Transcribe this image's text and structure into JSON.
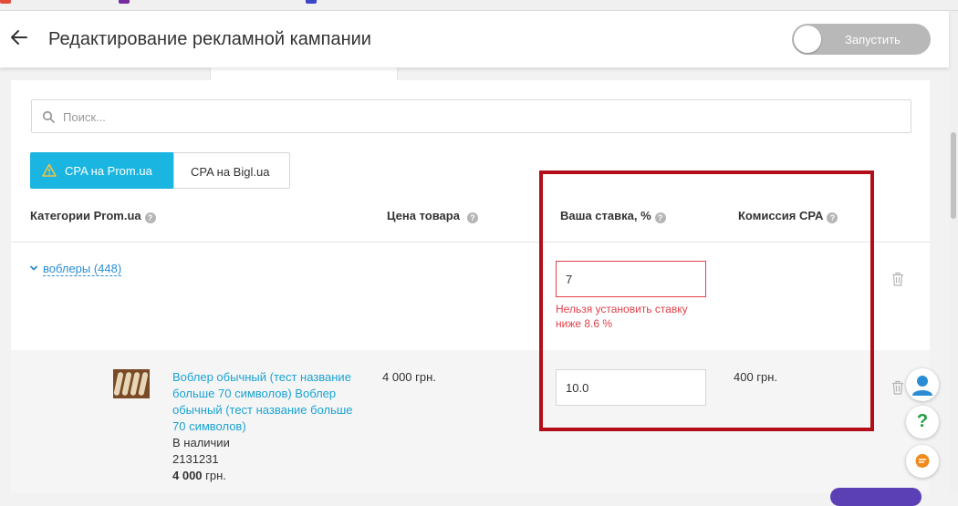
{
  "header": {
    "title": "Редактирование рекламной кампании",
    "launch_label": "Запустить"
  },
  "search": {
    "placeholder": "Поиск..."
  },
  "cpa_tabs": [
    {
      "label": "CPA на Prom.ua",
      "active": true,
      "icon": "warning-icon"
    },
    {
      "label": "CPA на Bigl.ua",
      "active": false
    }
  ],
  "table": {
    "headers": {
      "category": "Категории Prom.ua",
      "price": "Цена товара",
      "bid": "Ваша ставка, %",
      "commission": "Комиссия CPA"
    },
    "help_glyph": "?"
  },
  "category_row": {
    "label": "воблеры (448)",
    "bid_value": "7",
    "error": "Нельзя установить ставку ниже 8.6 %"
  },
  "product_row": {
    "name": "Воблер обычный (тест название больше 70 символов) Воблер обычный (тест название больше 70 символов)",
    "availability": "В наличии",
    "sku": "2131231",
    "price_bold": "4 000",
    "price_currency": " грн.",
    "price": "4 000 грн.",
    "bid_value": "10.0",
    "commission": "400 грн."
  },
  "help_widget": {
    "question_glyph": "?"
  },
  "colors": {
    "accent": "#1ab5e0",
    "link": "#2a8dd4",
    "error": "#e0414b",
    "highlight": "#b30d19",
    "toggle_off": "#b8b8b8"
  }
}
